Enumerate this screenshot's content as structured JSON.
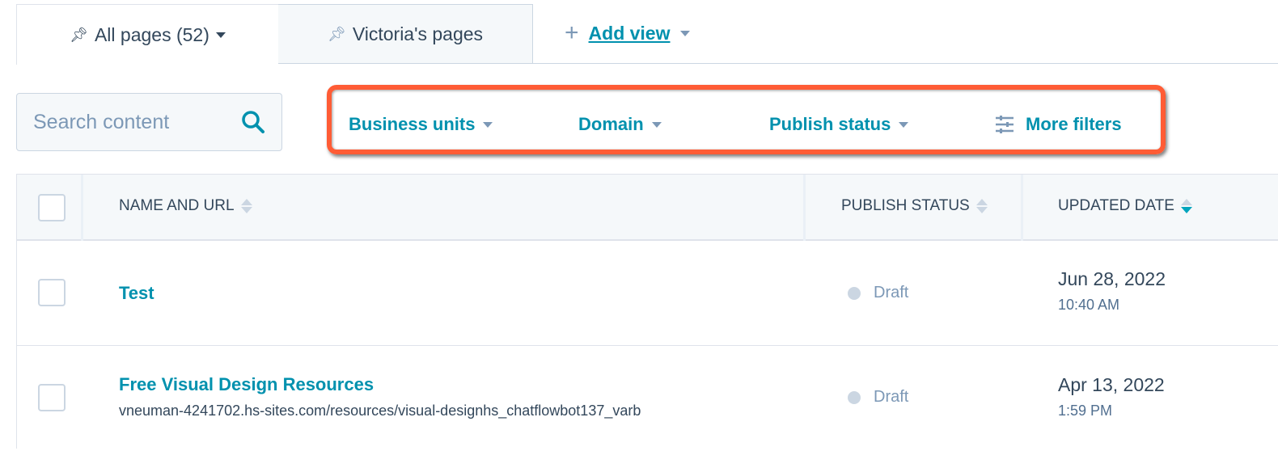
{
  "tabs": [
    {
      "label": "All pages (52)",
      "icon": "pin-icon",
      "active": true
    },
    {
      "label": "Victoria's pages",
      "icon": "pin-icon",
      "active": false
    }
  ],
  "add_view": {
    "label": "Add view"
  },
  "search": {
    "placeholder": "Search content"
  },
  "filters": {
    "business_units": "Business units",
    "domain": "Domain",
    "publish_status": "Publish status",
    "more_filters": "More filters"
  },
  "table": {
    "columns": [
      "NAME AND URL",
      "PUBLISH STATUS",
      "UPDATED DATE"
    ],
    "sorted_column": "UPDATED DATE",
    "rows": [
      {
        "name": "Test",
        "url": "",
        "status": "Draft",
        "date": "Jun 28, 2022",
        "time": "10:40 AM"
      },
      {
        "name": "Free Visual Design Resources",
        "url": "vneuman-4241702.hs-sites.com/resources/visual-designhs_chatflowbot137_varb",
        "status": "Draft",
        "date": "Apr 13, 2022",
        "time": "1:59 PM"
      }
    ]
  },
  "colors": {
    "accent": "#0091ae",
    "highlight": "#ff5c35",
    "text": "#33475b"
  }
}
